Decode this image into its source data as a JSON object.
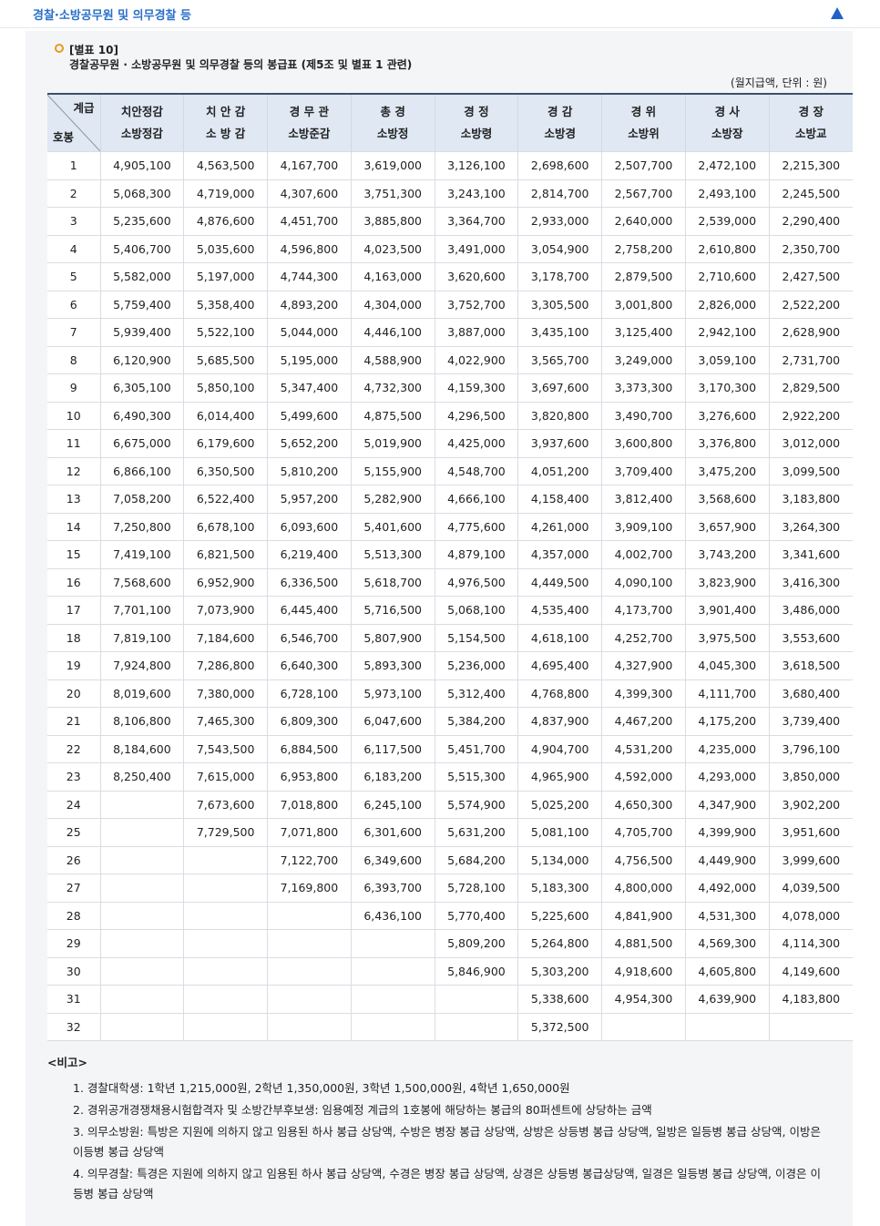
{
  "top_bar": {
    "title": "경찰·소방공무원 및 의무경찰 등"
  },
  "doc": {
    "label": "[별표 10]",
    "title": "경찰공무원 · 소방공무원 및 의무경찰 등의 봉급표 (제5조 및 별표 1 관련)",
    "unit": "(월지급액, 단위 : 원)"
  },
  "table": {
    "corner_top": "계급",
    "corner_bottom": "호봉",
    "columns": [
      [
        "치안정감",
        "소방정감"
      ],
      [
        "치 안 감",
        "소 방 감"
      ],
      [
        "경 무 관",
        "소방준감"
      ],
      [
        "총 경",
        "소방정"
      ],
      [
        "경 정",
        "소방령"
      ],
      [
        "경 감",
        "소방경"
      ],
      [
        "경 위",
        "소방위"
      ],
      [
        "경 사",
        "소방장"
      ],
      [
        "경 장",
        "소방교"
      ]
    ],
    "rows": [
      [
        "1",
        "4,905,100",
        "4,563,500",
        "4,167,700",
        "3,619,000",
        "3,126,100",
        "2,698,600",
        "2,507,700",
        "2,472,100",
        "2,215,300"
      ],
      [
        "2",
        "5,068,300",
        "4,719,000",
        "4,307,600",
        "3,751,300",
        "3,243,100",
        "2,814,700",
        "2,567,700",
        "2,493,100",
        "2,245,500"
      ],
      [
        "3",
        "5,235,600",
        "4,876,600",
        "4,451,700",
        "3,885,800",
        "3,364,700",
        "2,933,000",
        "2,640,000",
        "2,539,000",
        "2,290,400"
      ],
      [
        "4",
        "5,406,700",
        "5,035,600",
        "4,596,800",
        "4,023,500",
        "3,491,000",
        "3,054,900",
        "2,758,200",
        "2,610,800",
        "2,350,700"
      ],
      [
        "5",
        "5,582,000",
        "5,197,000",
        "4,744,300",
        "4,163,000",
        "3,620,600",
        "3,178,700",
        "2,879,500",
        "2,710,600",
        "2,427,500"
      ],
      [
        "6",
        "5,759,400",
        "5,358,400",
        "4,893,200",
        "4,304,000",
        "3,752,700",
        "3,305,500",
        "3,001,800",
        "2,826,000",
        "2,522,200"
      ],
      [
        "7",
        "5,939,400",
        "5,522,100",
        "5,044,000",
        "4,446,100",
        "3,887,000",
        "3,435,100",
        "3,125,400",
        "2,942,100",
        "2,628,900"
      ],
      [
        "8",
        "6,120,900",
        "5,685,500",
        "5,195,000",
        "4,588,900",
        "4,022,900",
        "3,565,700",
        "3,249,000",
        "3,059,100",
        "2,731,700"
      ],
      [
        "9",
        "6,305,100",
        "5,850,100",
        "5,347,400",
        "4,732,300",
        "4,159,300",
        "3,697,600",
        "3,373,300",
        "3,170,300",
        "2,829,500"
      ],
      [
        "10",
        "6,490,300",
        "6,014,400",
        "5,499,600",
        "4,875,500",
        "4,296,500",
        "3,820,800",
        "3,490,700",
        "3,276,600",
        "2,922,200"
      ],
      [
        "11",
        "6,675,000",
        "6,179,600",
        "5,652,200",
        "5,019,900",
        "4,425,000",
        "3,937,600",
        "3,600,800",
        "3,376,800",
        "3,012,000"
      ],
      [
        "12",
        "6,866,100",
        "6,350,500",
        "5,810,200",
        "5,155,900",
        "4,548,700",
        "4,051,200",
        "3,709,400",
        "3,475,200",
        "3,099,500"
      ],
      [
        "13",
        "7,058,200",
        "6,522,400",
        "5,957,200",
        "5,282,900",
        "4,666,100",
        "4,158,400",
        "3,812,400",
        "3,568,600",
        "3,183,800"
      ],
      [
        "14",
        "7,250,800",
        "6,678,100",
        "6,093,600",
        "5,401,600",
        "4,775,600",
        "4,261,000",
        "3,909,100",
        "3,657,900",
        "3,264,300"
      ],
      [
        "15",
        "7,419,100",
        "6,821,500",
        "6,219,400",
        "5,513,300",
        "4,879,100",
        "4,357,000",
        "4,002,700",
        "3,743,200",
        "3,341,600"
      ],
      [
        "16",
        "7,568,600",
        "6,952,900",
        "6,336,500",
        "5,618,700",
        "4,976,500",
        "4,449,500",
        "4,090,100",
        "3,823,900",
        "3,416,300"
      ],
      [
        "17",
        "7,701,100",
        "7,073,900",
        "6,445,400",
        "5,716,500",
        "5,068,100",
        "4,535,400",
        "4,173,700",
        "3,901,400",
        "3,486,000"
      ],
      [
        "18",
        "7,819,100",
        "7,184,600",
        "6,546,700",
        "5,807,900",
        "5,154,500",
        "4,618,100",
        "4,252,700",
        "3,975,500",
        "3,553,600"
      ],
      [
        "19",
        "7,924,800",
        "7,286,800",
        "6,640,300",
        "5,893,300",
        "5,236,000",
        "4,695,400",
        "4,327,900",
        "4,045,300",
        "3,618,500"
      ],
      [
        "20",
        "8,019,600",
        "7,380,000",
        "6,728,100",
        "5,973,100",
        "5,312,400",
        "4,768,800",
        "4,399,300",
        "4,111,700",
        "3,680,400"
      ],
      [
        "21",
        "8,106,800",
        "7,465,300",
        "6,809,300",
        "6,047,600",
        "5,384,200",
        "4,837,900",
        "4,467,200",
        "4,175,200",
        "3,739,400"
      ],
      [
        "22",
        "8,184,600",
        "7,543,500",
        "6,884,500",
        "6,117,500",
        "5,451,700",
        "4,904,700",
        "4,531,200",
        "4,235,000",
        "3,796,100"
      ],
      [
        "23",
        "8,250,400",
        "7,615,000",
        "6,953,800",
        "6,183,200",
        "5,515,300",
        "4,965,900",
        "4,592,000",
        "4,293,000",
        "3,850,000"
      ],
      [
        "24",
        "",
        "7,673,600",
        "7,018,800",
        "6,245,100",
        "5,574,900",
        "5,025,200",
        "4,650,300",
        "4,347,900",
        "3,902,200"
      ],
      [
        "25",
        "",
        "7,729,500",
        "7,071,800",
        "6,301,600",
        "5,631,200",
        "5,081,100",
        "4,705,700",
        "4,399,900",
        "3,951,600"
      ],
      [
        "26",
        "",
        "",
        "7,122,700",
        "6,349,600",
        "5,684,200",
        "5,134,000",
        "4,756,500",
        "4,449,900",
        "3,999,600"
      ],
      [
        "27",
        "",
        "",
        "7,169,800",
        "6,393,700",
        "5,728,100",
        "5,183,300",
        "4,800,000",
        "4,492,000",
        "4,039,500"
      ],
      [
        "28",
        "",
        "",
        "",
        "6,436,100",
        "5,770,400",
        "5,225,600",
        "4,841,900",
        "4,531,300",
        "4,078,000"
      ],
      [
        "29",
        "",
        "",
        "",
        "",
        "5,809,200",
        "5,264,800",
        "4,881,500",
        "4,569,300",
        "4,114,300"
      ],
      [
        "30",
        "",
        "",
        "",
        "",
        "5,846,900",
        "5,303,200",
        "4,918,600",
        "4,605,800",
        "4,149,600"
      ],
      [
        "31",
        "",
        "",
        "",
        "",
        "",
        "5,338,600",
        "4,954,300",
        "4,639,900",
        "4,183,800"
      ],
      [
        "32",
        "",
        "",
        "",
        "",
        "",
        "5,372,500",
        "",
        "",
        ""
      ]
    ]
  },
  "notes": {
    "title": "<비고>",
    "items": [
      "1. 경찰대학생: 1학년 1,215,000원, 2학년 1,350,000원, 3학년 1,500,000원, 4학년 1,650,000원",
      "2. 경위공개경쟁채용시험합격자 및 소방간부후보생: 임용예정 계급의 1호봉에 해당하는 봉급의 80퍼센트에 상당하는 금액",
      "3. 의무소방원: 특방은 지원에 의하지 않고 임용된 하사 봉급 상당액, 수방은 병장 봉급 상당액, 상방은 상등병 봉급 상당액, 일방은 일등병 봉급 상당액, 이방은 이등병 봉급 상당액",
      "4. 의무경찰: 특경은 지원에 의하지 않고 임용된 하사 봉급 상당액, 수경은 병장 봉급 상당액, 상경은 상등병 봉급상당액, 일경은 일등병 봉급 상당액, 이경은 이등병 봉급 상당액"
    ]
  }
}
